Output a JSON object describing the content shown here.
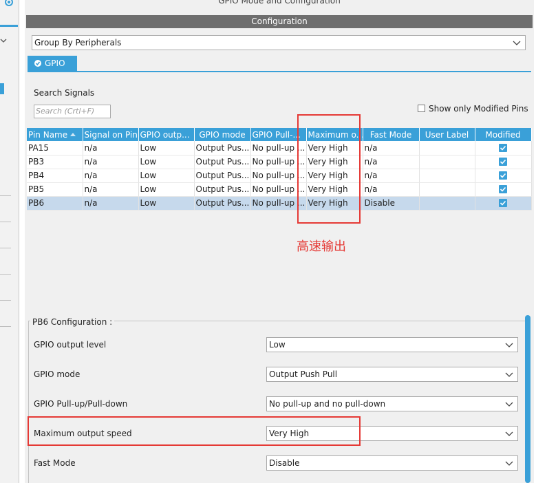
{
  "panel": {
    "top_title": "GPIO Mode and Configuration",
    "config_bar": "Configuration",
    "group_by": "Group By Peripherals",
    "tab_label": "GPIO"
  },
  "search": {
    "label": "Search Signals",
    "placeholder": "Search (Crtl+F)",
    "only_modified_label": "Show only Modified Pins"
  },
  "table": {
    "headers": [
      "Pin Name",
      "Signal on Pin",
      "GPIO outp...",
      "GPIO mode",
      "GPIO Pull-...",
      "Maximum o...",
      "Fast Mode",
      "User Label",
      "Modified"
    ],
    "rows": [
      [
        "PA15",
        "n/a",
        "Low",
        "Output Pus...",
        "No pull-up ...",
        "Very High",
        "n/a",
        ""
      ],
      [
        "PB3",
        "n/a",
        "Low",
        "Output Pus...",
        "No pull-up ...",
        "Very High",
        "n/a",
        ""
      ],
      [
        "PB4",
        "n/a",
        "Low",
        "Output Pus...",
        "No pull-up ...",
        "Very High",
        "n/a",
        ""
      ],
      [
        "PB5",
        "n/a",
        "Low",
        "Output Pus...",
        "No pull-up ...",
        "Very High",
        "n/a",
        ""
      ],
      [
        "PB6",
        "n/a",
        "Low",
        "Output Pus...",
        "No pull-up ...",
        "Very High",
        "Disable",
        ""
      ]
    ],
    "modified": [
      true,
      true,
      true,
      true,
      true
    ],
    "selected_row": 4
  },
  "annotation": "高速输出",
  "config": {
    "legend": "PB6 Configuration :",
    "fields": [
      {
        "label": "GPIO output level",
        "value": "Low"
      },
      {
        "label": "GPIO mode",
        "value": "Output Push Pull"
      },
      {
        "label": "GPIO Pull-up/Pull-down",
        "value": "No pull-up and no pull-down"
      },
      {
        "label": "Maximum output speed",
        "value": "Very High"
      },
      {
        "label": "Fast Mode",
        "value": "Disable"
      }
    ]
  },
  "colors": {
    "accent": "#3aa0d8",
    "header_bar": "#6e6e6e",
    "selected_row": "#c6d9ec",
    "annotation_red": "#e53935"
  }
}
